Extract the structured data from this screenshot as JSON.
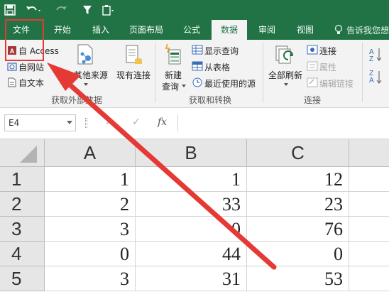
{
  "colors": {
    "accent": "#217346",
    "annotation": "#e53935"
  },
  "tabs": [
    {
      "label": "文件"
    },
    {
      "label": "开始"
    },
    {
      "label": "插入"
    },
    {
      "label": "页面布局"
    },
    {
      "label": "公式"
    },
    {
      "label": "数据"
    },
    {
      "label": "审阅"
    },
    {
      "label": "视图"
    }
  ],
  "tell_me": "告诉我您想",
  "ribbon": {
    "external": {
      "access": "自 Access",
      "web": "自网站",
      "text": "自文本",
      "other": "自其他来源",
      "existing": "现有连接",
      "group": "获取外部数据"
    },
    "transform": {
      "new_query_1": "新建",
      "new_query_2": "查询",
      "show_queries": "显示查询",
      "from_table": "从表格",
      "recent": "最近使用的源",
      "group": "获取和转换"
    },
    "connections": {
      "refresh": "全部刷新",
      "conn": "连接",
      "props": "属性",
      "edit_links": "编辑链接",
      "group": "连接"
    }
  },
  "name_box": "E4",
  "fx": "fx",
  "columns": [
    "A",
    "B",
    "C"
  ],
  "rows": [
    {
      "n": "1",
      "a": "1",
      "b": "1",
      "c": "12"
    },
    {
      "n": "2",
      "a": "2",
      "b": "33",
      "c": "23"
    },
    {
      "n": "3",
      "a": "3",
      "b": "0",
      "c": "76"
    },
    {
      "n": "4",
      "a": "0",
      "b": "44",
      "c": "0"
    },
    {
      "n": "5",
      "a": "3",
      "b": "31",
      "c": "53"
    }
  ]
}
